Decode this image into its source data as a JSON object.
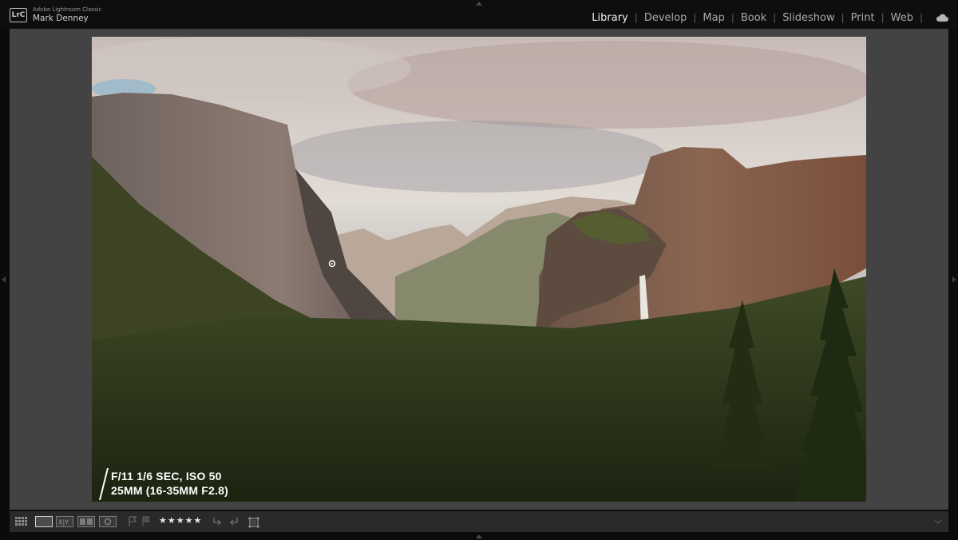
{
  "app": {
    "logo": "LrC",
    "product": "Adobe Lightroom Classic",
    "user": "Mark Denney"
  },
  "modules": [
    {
      "label": "Library",
      "active": true
    },
    {
      "label": "Develop",
      "active": false
    },
    {
      "label": "Map",
      "active": false
    },
    {
      "label": "Book",
      "active": false
    },
    {
      "label": "Slideshow",
      "active": false
    },
    {
      "label": "Print",
      "active": false
    },
    {
      "label": "Web",
      "active": false
    }
  ],
  "overlay": {
    "line1": "F/11 1/6 SEC, ISO 50",
    "line2": "25MM (16-35MM F2.8)"
  },
  "toolbar": {
    "rating": "★★★★★",
    "icons": [
      "grid-view-icon",
      "loupe-view-icon",
      "compare-view-icon",
      "survey-view-icon",
      "people-view-icon",
      "flag-icon",
      "reject-flag-icon",
      "rotate-left-icon",
      "rotate-right-icon",
      "crop-overlay-icon"
    ]
  },
  "colors": {
    "accent": "#f0f0f0",
    "panel": "#434343",
    "chrome": "#0e0e0e",
    "toolbar": "#2a2a2a"
  }
}
